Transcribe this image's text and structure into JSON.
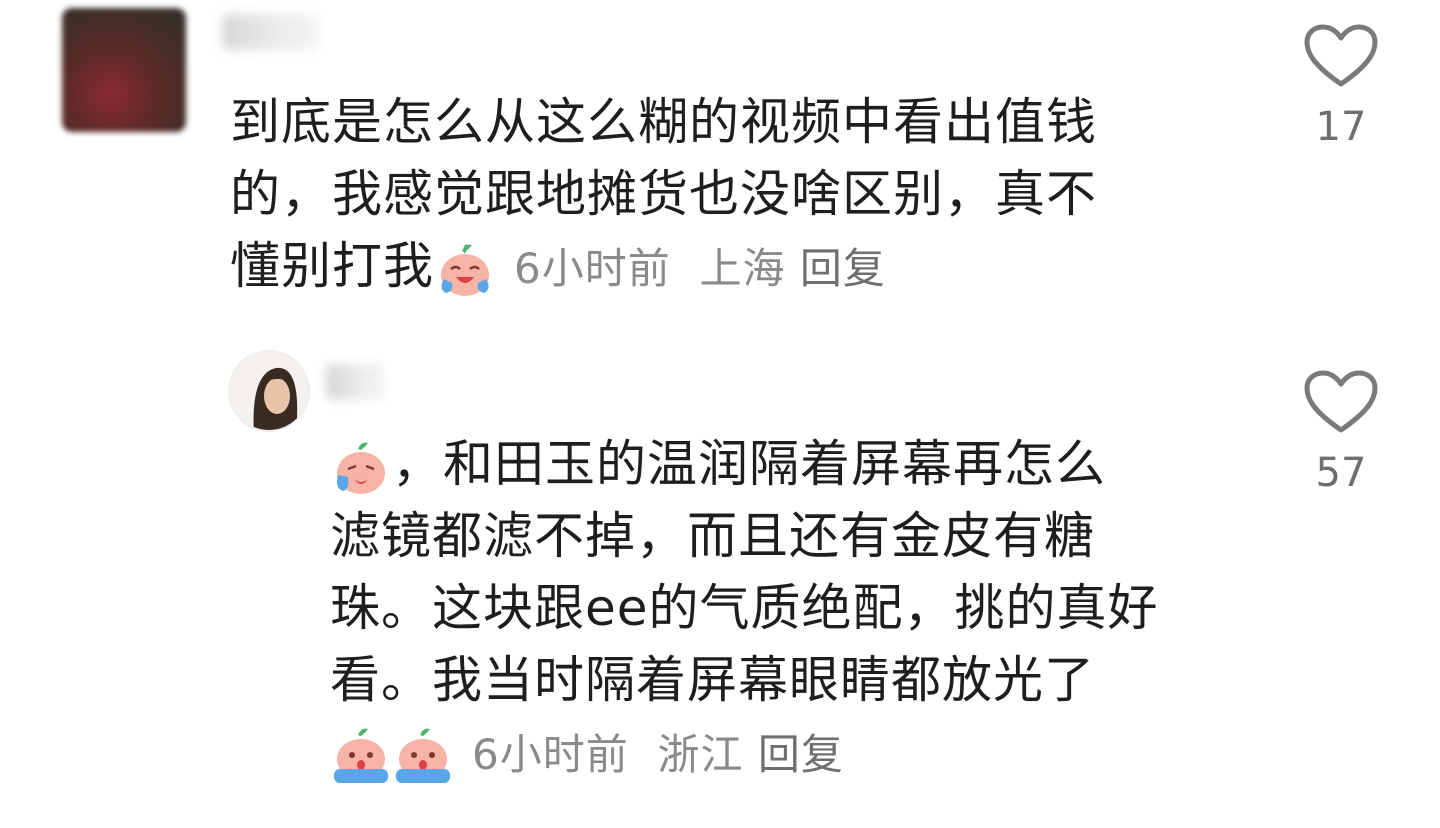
{
  "comments": [
    {
      "author": "",
      "lines": [
        "到底是怎么从这么糊的视频中看出值钱",
        "的，我感觉跟地摊货也没啥区别，真不",
        "懂别打我"
      ],
      "emoji": "crying-laughing-peach-emoji",
      "time": "6小时前",
      "location": "上海",
      "reply_label": "回复",
      "likes": "17"
    },
    {
      "author": "",
      "lines": [
        "，和田玉的温润隔着屏幕再怎么",
        "滤镜都滤不掉，而且还有金皮有糖",
        "珠。这块跟ee的气质绝配，挑的真好",
        "看。我当时隔着屏幕眼睛都放光了"
      ],
      "lead_emoji": "crying-peach-emoji",
      "trail_emojis": [
        "sobbing-peach-emoji",
        "sobbing-peach-emoji"
      ],
      "time": "6小时前",
      "location": "浙江",
      "reply_label": "回复",
      "likes": "57"
    }
  ],
  "colors": {
    "text": "#1e1e1e",
    "meta": "#8a8a8a",
    "like_outline": "#7a7a7a"
  },
  "icons": {
    "like": "heart-outline-icon"
  }
}
